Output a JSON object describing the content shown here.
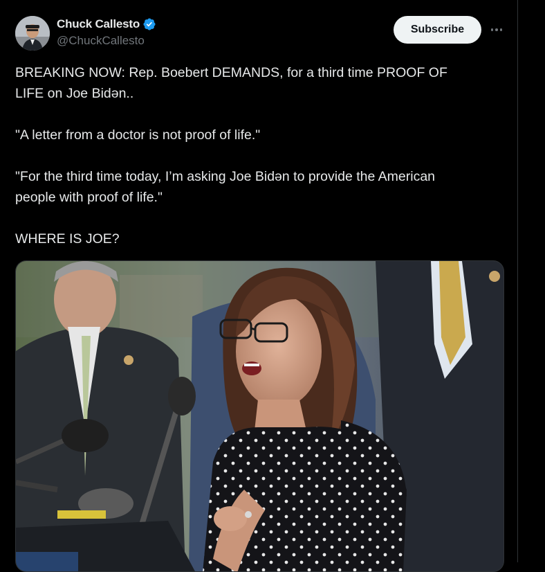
{
  "post": {
    "author": {
      "display_name": "Chuck Callesto",
      "handle": "@ChuckCallesto",
      "verified": true
    },
    "subscribe_label": "Subscribe",
    "text": {
      "line1": "BREAKING NOW: Rep. Boebert DEMANDS, for a third time PROOF OF",
      "line2": "LIFE on Joe Bidən..",
      "para2": "\"A letter from a doctor is not proof of life.\"",
      "para3_line1": "\"For the third time today, I’m asking Joe Bidən to provide the American",
      "para3_line2": "people with proof of life.\"",
      "para4": "WHERE IS JOE?"
    },
    "media": {
      "type": "photo",
      "description_icon": "photo-woman-speaking-at-podium"
    }
  },
  "icons": {
    "verified": "verified-badge-icon",
    "more": "more-options-icon"
  },
  "colors": {
    "background": "#000000",
    "text_primary": "#e7e9ea",
    "text_secondary": "#71767b",
    "verified_blue": "#1d9bf0",
    "button_bg": "#eff3f4"
  }
}
